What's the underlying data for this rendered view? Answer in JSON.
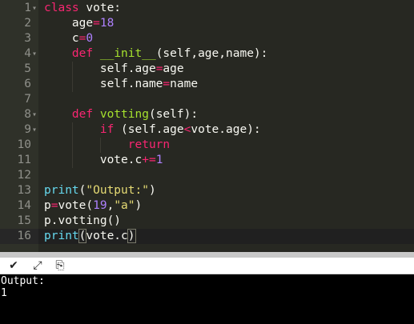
{
  "editor": {
    "lines": [
      {
        "n": "1",
        "fold": true,
        "tokens": [
          [
            "kw",
            "class"
          ],
          [
            "plain",
            " vote:"
          ]
        ]
      },
      {
        "n": "2",
        "fold": false,
        "tokens": [
          [
            "plain",
            "    age"
          ],
          [
            "op",
            "="
          ],
          [
            "num",
            "18"
          ]
        ]
      },
      {
        "n": "3",
        "fold": false,
        "tokens": [
          [
            "plain",
            "    c"
          ],
          [
            "op",
            "="
          ],
          [
            "num",
            "0"
          ]
        ]
      },
      {
        "n": "4",
        "fold": true,
        "tokens": [
          [
            "plain",
            "    "
          ],
          [
            "kw",
            "def"
          ],
          [
            "plain",
            " "
          ],
          [
            "fn",
            "__init__"
          ],
          [
            "plain",
            "(self,age,name):"
          ]
        ]
      },
      {
        "n": "5",
        "fold": false,
        "tokens": [
          [
            "plain",
            "        self.age"
          ],
          [
            "op",
            "="
          ],
          [
            "plain",
            "age"
          ]
        ]
      },
      {
        "n": "6",
        "fold": false,
        "tokens": [
          [
            "plain",
            "        self.name"
          ],
          [
            "op",
            "="
          ],
          [
            "plain",
            "name"
          ]
        ]
      },
      {
        "n": "7",
        "fold": false,
        "tokens": []
      },
      {
        "n": "8",
        "fold": true,
        "tokens": [
          [
            "plain",
            "    "
          ],
          [
            "kw",
            "def"
          ],
          [
            "plain",
            " "
          ],
          [
            "fn",
            "votting"
          ],
          [
            "plain",
            "(self):"
          ]
        ]
      },
      {
        "n": "9",
        "fold": true,
        "tokens": [
          [
            "plain",
            "        "
          ],
          [
            "kw",
            "if"
          ],
          [
            "plain",
            " (self.age"
          ],
          [
            "op",
            "<"
          ],
          [
            "plain",
            "vote.age):"
          ]
        ]
      },
      {
        "n": "10",
        "fold": false,
        "tokens": [
          [
            "plain",
            "            "
          ],
          [
            "kw",
            "return"
          ]
        ]
      },
      {
        "n": "11",
        "fold": false,
        "tokens": [
          [
            "plain",
            "        vote.c"
          ],
          [
            "op",
            "+="
          ],
          [
            "num",
            "1"
          ]
        ]
      },
      {
        "n": "12",
        "fold": false,
        "tokens": []
      },
      {
        "n": "13",
        "fold": false,
        "tokens": [
          [
            "kw2",
            "print"
          ],
          [
            "plain",
            "("
          ],
          [
            "str",
            "\"Output:\""
          ],
          [
            "plain",
            ")"
          ]
        ]
      },
      {
        "n": "14",
        "fold": false,
        "tokens": [
          [
            "plain",
            "p"
          ],
          [
            "op",
            "="
          ],
          [
            "plain",
            "vote("
          ],
          [
            "num",
            "19"
          ],
          [
            "plain",
            ","
          ],
          [
            "str",
            "\"a\""
          ],
          [
            "plain",
            ")"
          ]
        ]
      },
      {
        "n": "15",
        "fold": false,
        "tokens": [
          [
            "plain",
            "p.votting()"
          ]
        ]
      },
      {
        "n": "16",
        "fold": false,
        "active": true,
        "tokens": [
          [
            "kw2",
            "print"
          ],
          [
            "plain",
            "(vote.c)"
          ]
        ]
      }
    ]
  },
  "toolbar": {
    "icons": [
      "chevron-down-icon",
      "expand-icon",
      "copy-icon"
    ],
    "glyphs": [
      "✔",
      "⤢",
      "⎘"
    ]
  },
  "console": {
    "lines": [
      "Output:",
      "1"
    ]
  }
}
